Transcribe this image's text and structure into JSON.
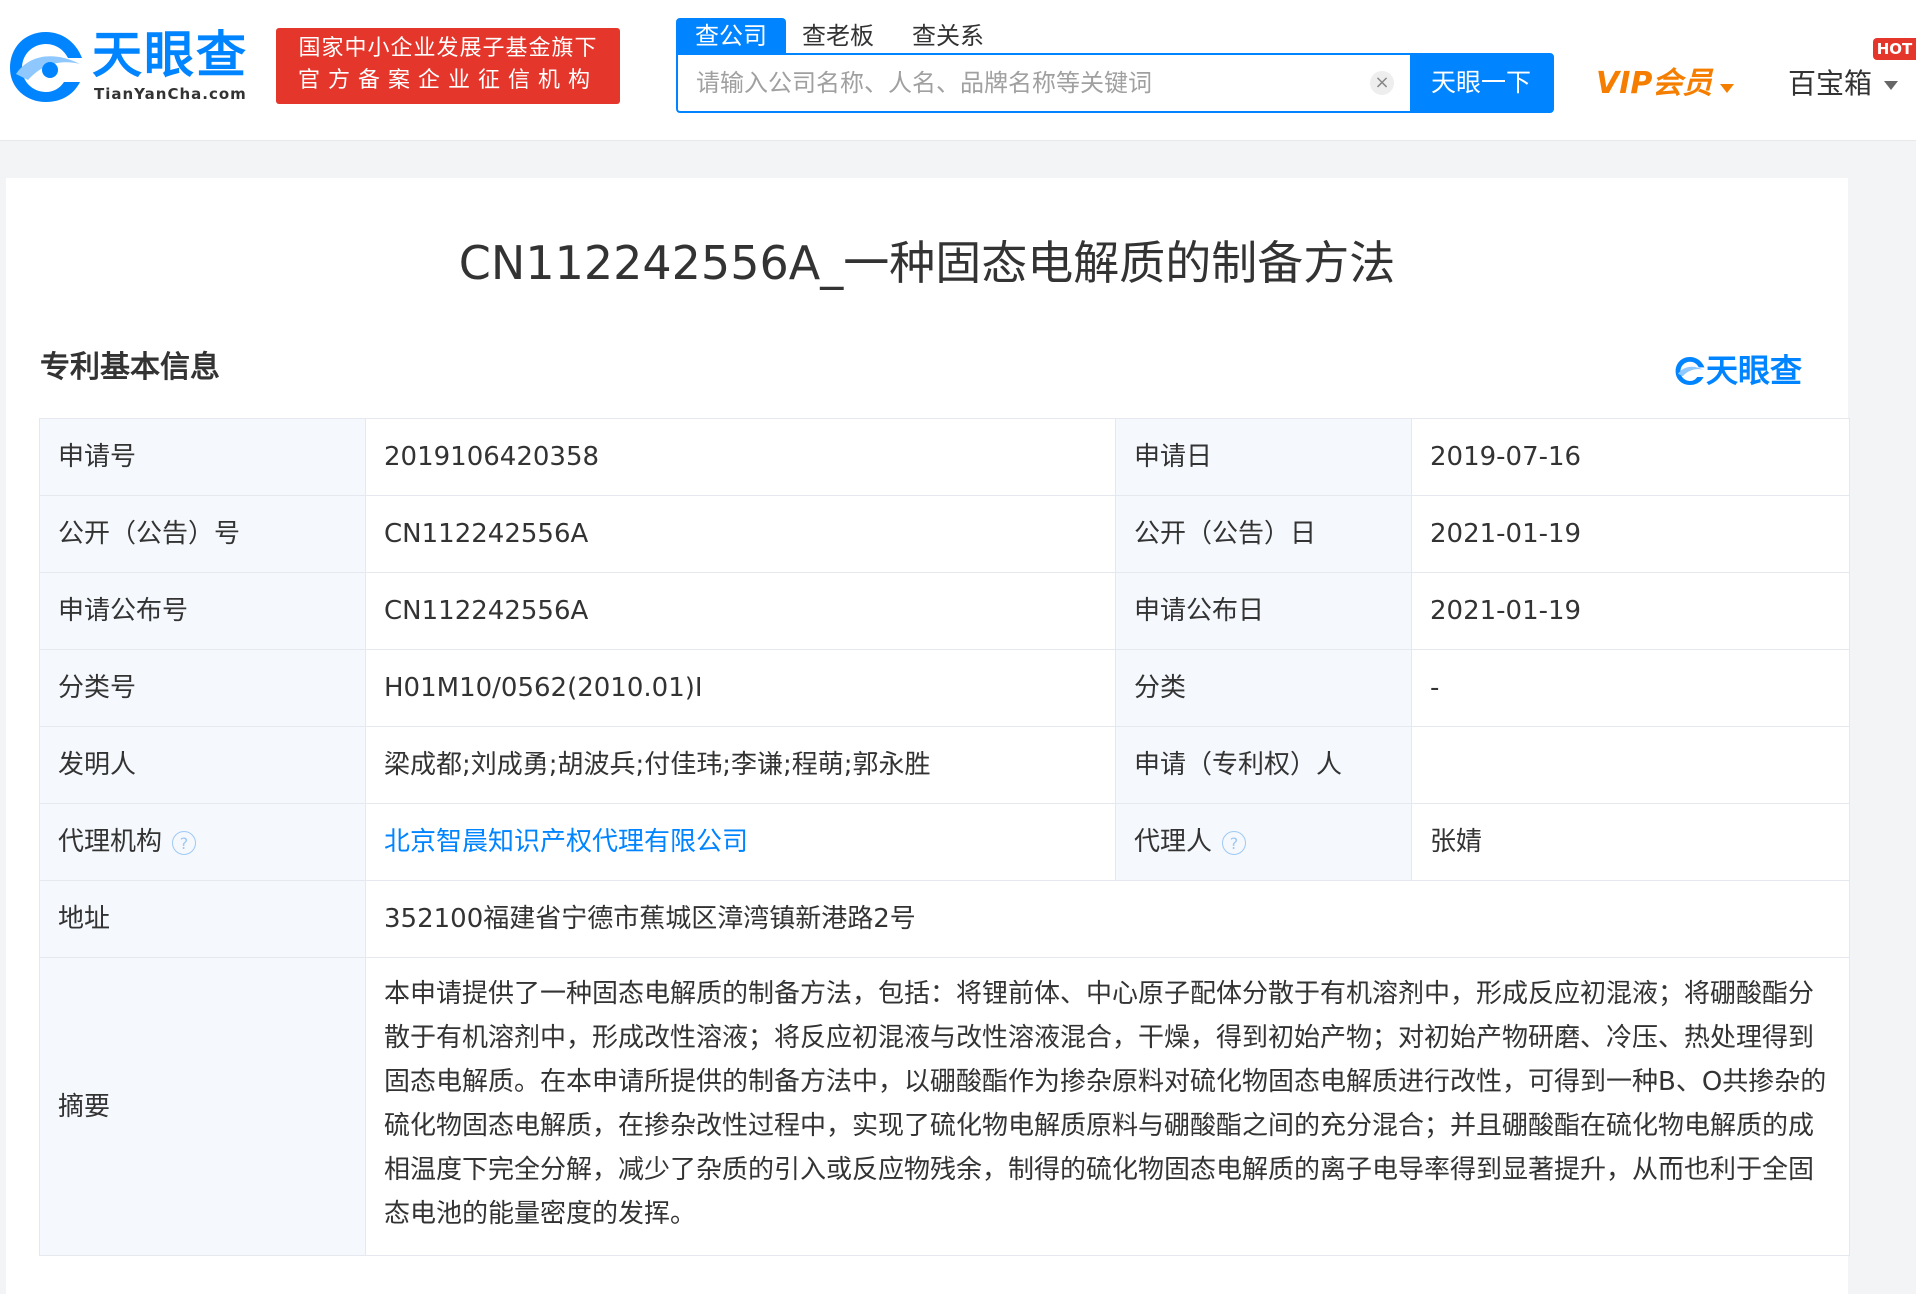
{
  "header": {
    "logo_text": "天眼查",
    "logo_domain": "TianYanCha.com",
    "org_badge": {
      "line1": "国家中小企业发展子基金旗下",
      "line2": "官方备案企业征信机构"
    },
    "search": {
      "tabs": [
        {
          "label": "查公司",
          "active": true
        },
        {
          "label": "查老板",
          "active": false
        },
        {
          "label": "查关系",
          "active": false
        }
      ],
      "placeholder": "请输入公司名称、人名、品牌名称等关键词",
      "value": "",
      "clear_label": "×",
      "button_label": "天眼一下"
    },
    "vip_label": "VIP会员",
    "hot_badge": "HOT",
    "toolbox_label": "百宝箱"
  },
  "page": {
    "title": "CN112242556A_一种固态电解质的制备方法",
    "section_title": "专利基本信息",
    "brand_text": "天眼查"
  },
  "patent": {
    "rows": [
      {
        "l1": "申请号",
        "v1": "2019106420358",
        "l2": "申请日",
        "v2": "2019-07-16"
      },
      {
        "l1": "公开（公告）号",
        "v1": "CN112242556A",
        "l2": "公开（公告）日",
        "v2": "2021-01-19"
      },
      {
        "l1": "申请公布号",
        "v1": "CN112242556A",
        "l2": "申请公布日",
        "v2": "2021-01-19"
      },
      {
        "l1": "分类号",
        "v1": "H01M10/0562(2010.01)I",
        "l2": "分类",
        "v2": "-"
      },
      {
        "l1": "发明人",
        "v1": "梁成都;刘成勇;胡波兵;付佳玮;李谦;程萌;郭永胜",
        "l2": "申请（专利权）人",
        "v2": ""
      },
      {
        "l1": "代理机构",
        "v1": "北京智晨知识产权代理有限公司",
        "l2": "代理人",
        "v2": "张婧"
      }
    ],
    "address_label": "地址",
    "address_value": "352100福建省宁德市蕉城区漳湾镇新港路2号",
    "abstract_label": "摘要",
    "abstract_value": "本申请提供了一种固态电解质的制备方法，包括：将锂前体、中心原子配体分散于有机溶剂中，形成反应初混液；将硼酸酯分散于有机溶剂中，形成改性溶液；将反应初混液与改性溶液混合，干燥，得到初始产物；对初始产物研磨、冷压、热处理得到固态电解质。在本申请所提供的制备方法中，以硼酸酯作为掺杂原料对硫化物固态电解质进行改性，可得到一种B、O共掺杂的硫化物固态电解质，在掺杂改性过程中，实现了硫化物电解质原料与硼酸酯之间的充分混合；并且硼酸酯在硫化物电解质的成相温度下完全分解，减少了杂质的引入或反应物残余，制得的硫化物固态电解质的离子电导率得到显著提升，从而也利于全固态电池的能量密度的发挥。",
    "help_glyph": "?"
  },
  "colors": {
    "brand_blue": "#0084ff",
    "badge_red": "#e5362c",
    "vip_orange": "#f57e00",
    "label_bg": "#f5f8fc"
  },
  "icons": {
    "logo": "tianyancha-eye-logo-icon",
    "clear": "clear-x-icon",
    "help": "question-circle-icon",
    "caret": "caret-down-icon"
  }
}
